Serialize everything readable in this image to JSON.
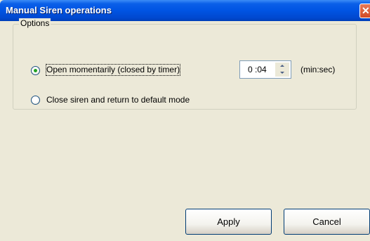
{
  "window": {
    "title": "Manual Siren operations",
    "close_glyph": "✕"
  },
  "options": {
    "group_label": "Options",
    "open_label": "Open momentarily (closed by timer)",
    "close_label": "Close siren and return to default mode",
    "selected": "open"
  },
  "timer": {
    "value": "0 :04",
    "unit": "(min:sec)"
  },
  "buttons": {
    "apply": "Apply",
    "cancel": "Cancel"
  },
  "colors": {
    "titlebar": "#0054E3",
    "face": "#ECE9D8",
    "radio_dot": "#21A121"
  }
}
